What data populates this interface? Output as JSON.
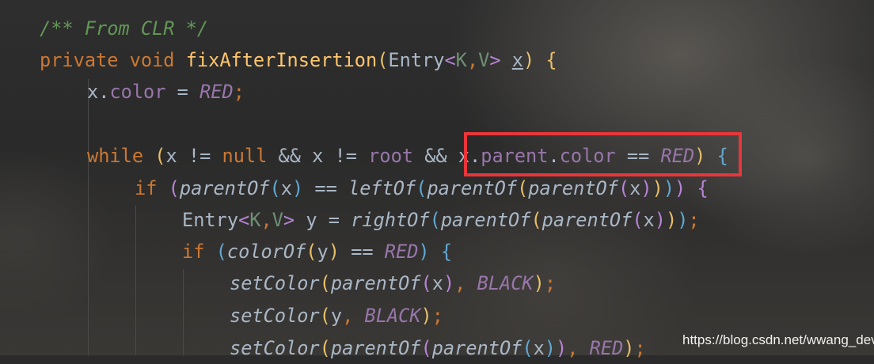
{
  "editor": {
    "lines": [
      [
        {
          "text": "/** From CLR */",
          "kind": "com"
        }
      ],
      [
        {
          "text": "private",
          "kind": "kw"
        },
        {
          "text": " "
        },
        {
          "text": "void",
          "kind": "kw"
        },
        {
          "text": " "
        },
        {
          "text": "fixAfterInsertion",
          "kind": "fn"
        },
        {
          "text": "(",
          "kind": "p1"
        },
        {
          "text": "Entry",
          "kind": "id"
        },
        {
          "text": "<",
          "kind": "p2"
        },
        {
          "text": "K",
          "kind": "gen"
        },
        {
          "text": ",",
          "kind": "kw"
        },
        {
          "text": "V",
          "kind": "gen"
        },
        {
          "text": ">",
          "kind": "p2"
        },
        {
          "text": " "
        },
        {
          "text": "x",
          "kind": "param"
        },
        {
          "text": ")",
          "kind": "p1"
        },
        {
          "text": " "
        },
        {
          "text": "{",
          "kind": "p1"
        }
      ],
      [
        {
          "text": "x",
          "kind": "id"
        },
        {
          "text": "."
        },
        {
          "text": "color",
          "kind": "field"
        },
        {
          "text": " = "
        },
        {
          "text": "RED",
          "kind": "const"
        },
        {
          "text": ";",
          "kind": "kw"
        }
      ],
      [],
      [
        {
          "text": "while",
          "kind": "kw"
        },
        {
          "text": " "
        },
        {
          "text": "(",
          "kind": "p1"
        },
        {
          "text": "x != "
        },
        {
          "text": "null",
          "kind": "kw"
        },
        {
          "text": " && x != "
        },
        {
          "text": "root",
          "kind": "field"
        },
        {
          "text": " && x."
        },
        {
          "text": "parent",
          "kind": "field"
        },
        {
          "text": "."
        },
        {
          "text": "color",
          "kind": "field"
        },
        {
          "text": " == "
        },
        {
          "text": "RED",
          "kind": "const"
        },
        {
          "text": ")",
          "kind": "p1"
        },
        {
          "text": " "
        },
        {
          "text": "{",
          "kind": "p3"
        }
      ],
      [
        {
          "text": "if",
          "kind": "kw"
        },
        {
          "text": " "
        },
        {
          "text": "(",
          "kind": "p2"
        },
        {
          "text": "parentOf",
          "kind": "call"
        },
        {
          "text": "(",
          "kind": "p3"
        },
        {
          "text": "x"
        },
        {
          "text": ")",
          "kind": "p3"
        },
        {
          "text": " == "
        },
        {
          "text": "leftOf",
          "kind": "call"
        },
        {
          "text": "(",
          "kind": "p3"
        },
        {
          "text": "parentOf",
          "kind": "call"
        },
        {
          "text": "(",
          "kind": "p1"
        },
        {
          "text": "parentOf",
          "kind": "call"
        },
        {
          "text": "(",
          "kind": "p2"
        },
        {
          "text": "x"
        },
        {
          "text": ")",
          "kind": "p2"
        },
        {
          "text": ")",
          "kind": "p1"
        },
        {
          "text": ")",
          "kind": "p3"
        },
        {
          "text": ")",
          "kind": "p2"
        },
        {
          "text": " "
        },
        {
          "text": "{",
          "kind": "p2"
        }
      ],
      [
        {
          "text": "Entry",
          "kind": "id"
        },
        {
          "text": "<",
          "kind": "p2"
        },
        {
          "text": "K",
          "kind": "gen"
        },
        {
          "text": ",",
          "kind": "kw"
        },
        {
          "text": "V",
          "kind": "gen"
        },
        {
          "text": ">",
          "kind": "p2"
        },
        {
          "text": " y = "
        },
        {
          "text": "rightOf",
          "kind": "call"
        },
        {
          "text": "(",
          "kind": "p3"
        },
        {
          "text": "parentOf",
          "kind": "call"
        },
        {
          "text": "(",
          "kind": "p1"
        },
        {
          "text": "parentOf",
          "kind": "call"
        },
        {
          "text": "(",
          "kind": "p2"
        },
        {
          "text": "x"
        },
        {
          "text": ")",
          "kind": "p2"
        },
        {
          "text": ")",
          "kind": "p1"
        },
        {
          "text": ")",
          "kind": "p3"
        },
        {
          "text": ";",
          "kind": "kw"
        }
      ],
      [
        {
          "text": "if",
          "kind": "kw"
        },
        {
          "text": " "
        },
        {
          "text": "(",
          "kind": "p3"
        },
        {
          "text": "colorOf",
          "kind": "call"
        },
        {
          "text": "(",
          "kind": "p1"
        },
        {
          "text": "y"
        },
        {
          "text": ")",
          "kind": "p1"
        },
        {
          "text": " == "
        },
        {
          "text": "RED",
          "kind": "const"
        },
        {
          "text": ")",
          "kind": "p3"
        },
        {
          "text": " "
        },
        {
          "text": "{",
          "kind": "p3"
        }
      ],
      [
        {
          "text": "setColor",
          "kind": "call"
        },
        {
          "text": "(",
          "kind": "p1"
        },
        {
          "text": "parentOf",
          "kind": "call"
        },
        {
          "text": "(",
          "kind": "p2"
        },
        {
          "text": "x"
        },
        {
          "text": ")",
          "kind": "p2"
        },
        {
          "text": ", ",
          "kind": "kw"
        },
        {
          "text": "BLACK",
          "kind": "const"
        },
        {
          "text": ")",
          "kind": "p1"
        },
        {
          "text": ";",
          "kind": "kw"
        }
      ],
      [
        {
          "text": "setColor",
          "kind": "call"
        },
        {
          "text": "(",
          "kind": "p1"
        },
        {
          "text": "y"
        },
        {
          "text": ", ",
          "kind": "kw"
        },
        {
          "text": "BLACK",
          "kind": "const"
        },
        {
          "text": ")",
          "kind": "p1"
        },
        {
          "text": ";",
          "kind": "kw"
        }
      ],
      [
        {
          "text": "setColor",
          "kind": "call"
        },
        {
          "text": "(",
          "kind": "p1"
        },
        {
          "text": "parentOf",
          "kind": "call"
        },
        {
          "text": "(",
          "kind": "p2"
        },
        {
          "text": "parentOf",
          "kind": "call"
        },
        {
          "text": "(",
          "kind": "p3"
        },
        {
          "text": "x"
        },
        {
          "text": ")",
          "kind": "p3"
        },
        {
          "text": ")",
          "kind": "p2"
        },
        {
          "text": ", ",
          "kind": "kw"
        },
        {
          "text": "RED",
          "kind": "const"
        },
        {
          "text": ")",
          "kind": "p1"
        },
        {
          "text": ";",
          "kind": "kw"
        }
      ]
    ]
  },
  "highlight": {
    "label": "x.parent.color == RED",
    "color": "#e8363a"
  },
  "watermark": "https://blog.csdn.net/wwang_dev"
}
